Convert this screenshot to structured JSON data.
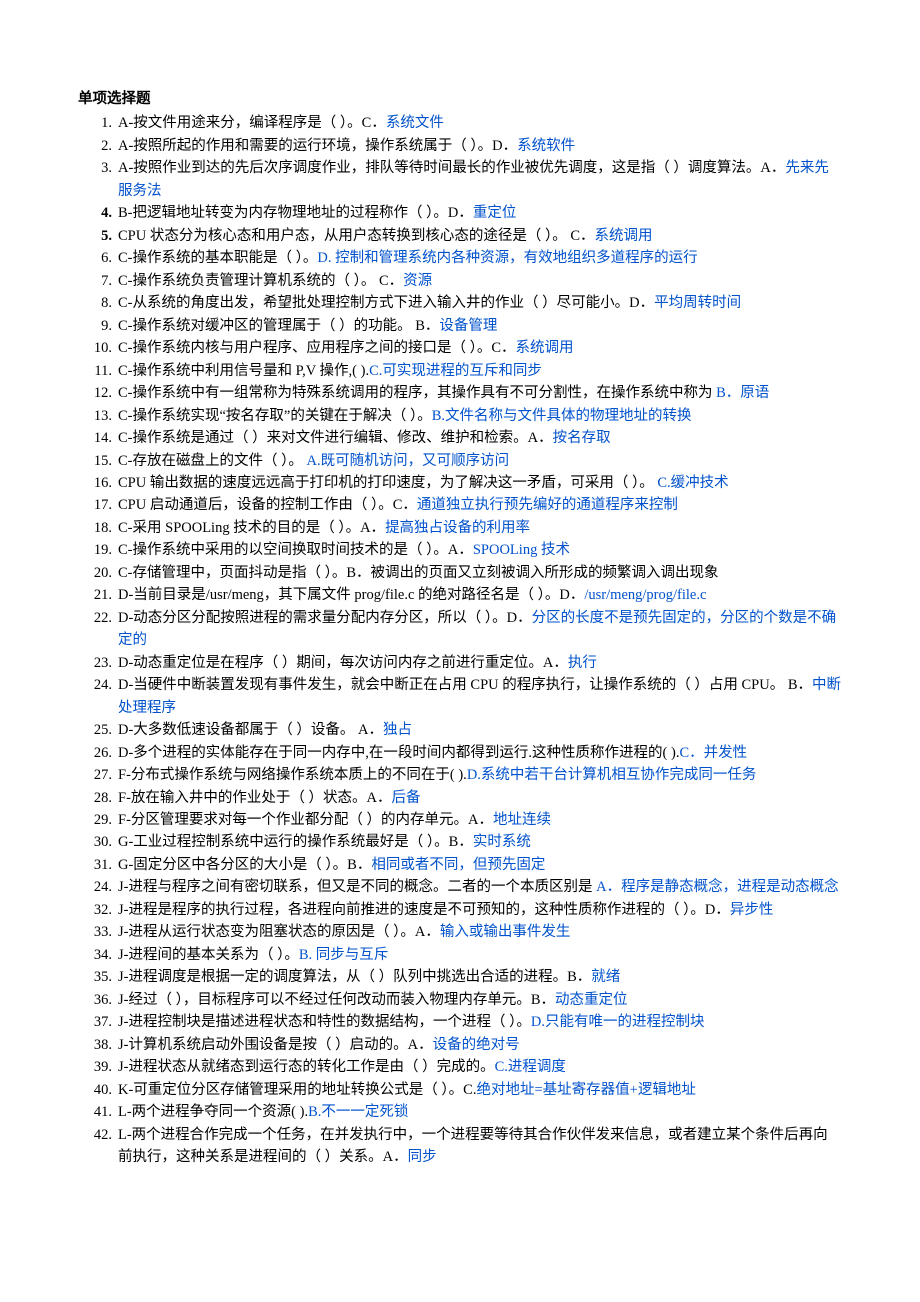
{
  "heading": "单项选择题",
  "items": [
    {
      "num": "1.",
      "bold": false,
      "parts": [
        {
          "t": "A-按文件用途来分，编译程序是（     ）。C．"
        },
        {
          "t": "系统文件",
          "ans": true
        }
      ]
    },
    {
      "num": "2.",
      "bold": false,
      "parts": [
        {
          "t": "A-按照所起的作用和需要的运行环境，操作系统属于（     ）。D．"
        },
        {
          "t": "系统软件",
          "ans": true
        }
      ]
    },
    {
      "num": "3.",
      "bold": false,
      "parts": [
        {
          "t": "A-按照作业到达的先后次序调度作业，排队等待时间最长的作业被优先调度，这是指（  ）调度算法。A．"
        },
        {
          "t": "先来先服务法",
          "ans": true
        }
      ]
    },
    {
      "num": "4.",
      "bold": true,
      "parts": [
        {
          "t": "B-把逻辑地址转变为内存物理地址的过程称作（    ）。D．"
        },
        {
          "t": "重定位",
          "ans": true
        }
      ]
    },
    {
      "num": "5.",
      "bold": true,
      "parts": [
        {
          "t": "CPU 状态分为核心态和用户态，从用户态转换到核心态的途径是（    ）。 C．"
        },
        {
          "t": "系统调用",
          "ans": true
        }
      ]
    },
    {
      "num": "6.",
      "bold": false,
      "parts": [
        {
          "t": "C-操作系统的基本职能是（    ）。"
        },
        {
          "t": "D. 控制和管理系统内各种资源，有效地组织多道程序的运行",
          "ans": true
        }
      ]
    },
    {
      "num": "7.",
      "bold": false,
      "parts": [
        {
          "t": "C-操作系统负责管理计算机系统的（     ）。  C．"
        },
        {
          "t": "资源",
          "ans": true
        }
      ]
    },
    {
      "num": "8.",
      "bold": false,
      "parts": [
        {
          "t": "C-从系统的角度出发，希望批处理控制方式下进入输入井的作业（     ）尽可能小。D．"
        },
        {
          "t": "平均周转时间",
          "ans": true
        }
      ]
    },
    {
      "num": "9.",
      "bold": false,
      "parts": [
        {
          "t": "C-操作系统对缓冲区的管理属于（     ）的功能。  B．"
        },
        {
          "t": "设备管理",
          "ans": true
        }
      ]
    },
    {
      "num": "10.",
      "bold": false,
      "parts": [
        {
          "t": "C-操作系统内核与用户程序、应用程序之间的接口是（     ）。C．"
        },
        {
          "t": "系统调用",
          "ans": true
        }
      ]
    },
    {
      "num": "11.",
      "bold": false,
      "parts": [
        {
          "t": "C-操作系统中利用信号量和 P,V 操作,( )."
        },
        {
          "t": "C.可实现进程的互斥和同步",
          "ans": true
        }
      ]
    },
    {
      "num": "12.",
      "bold": false,
      "parts": [
        {
          "t": "C-操作系统中有一组常称为特殊系统调用的程序，其操作具有不可分割性，在操作系统中称为 "
        },
        {
          "t": "B．原语",
          "ans": true
        }
      ]
    },
    {
      "num": "13.",
      "bold": false,
      "parts": [
        {
          "t": "C-操作系统实现“按名存取”的关键在于解决（    ）。"
        },
        {
          "t": "B.文件名称与文件具体的物理地址的转换",
          "ans": true
        }
      ]
    },
    {
      "num": "14.",
      "bold": false,
      "parts": [
        {
          "t": "C-操作系统是通过（     ）来对文件进行编辑、修改、维护和检索。A．"
        },
        {
          "t": "按名存取",
          "ans": true
        }
      ]
    },
    {
      "num": "15.",
      "bold": false,
      "parts": [
        {
          "t": "C-存放在磁盘上的文件（     ）。  "
        },
        {
          "t": "A.既可随机访问，又可顺序访问",
          "ans": true
        }
      ]
    },
    {
      "num": "16.",
      "bold": false,
      "parts": [
        {
          "t": "CPU 输出数据的速度远远高于打印机的打印速度，为了解决这一矛盾，可采用（    ）。   "
        },
        {
          "t": "C.缓冲技术",
          "ans": true
        }
      ]
    },
    {
      "num": "17.",
      "bold": false,
      "parts": [
        {
          "t": "CPU 启动通道后，设备的控制工作由（    ）。C．"
        },
        {
          "t": "通道独立执行预先编好的通道程序来控制",
          "ans": true
        }
      ]
    },
    {
      "num": "18.",
      "bold": false,
      "parts": [
        {
          "t": "C-采用 SPOOLing 技术的目的是（    ）。A．"
        },
        {
          "t": "提高独占设备的利用率",
          "ans": true
        }
      ]
    },
    {
      "num": "19.",
      "bold": false,
      "parts": [
        {
          "t": "C-操作系统中采用的以空间换取时间技术的是（    ）。A．"
        },
        {
          "t": "SPOOLing 技术",
          "ans": true
        }
      ]
    },
    {
      "num": "20.",
      "bold": false,
      "parts": [
        {
          "t": "C-存储管理中，页面抖动是指（    ）。B．被调出的页面又立刻被调入所形成的频繁调入调出现象"
        }
      ]
    },
    {
      "num": "21.",
      "bold": false,
      "parts": [
        {
          "t": "D-当前目录是/usr/meng，其下属文件 prog/file.c 的绝对路径名是（     ）。D．"
        },
        {
          "t": "/usr/meng/prog/file.c",
          "ans": true
        }
      ]
    },
    {
      "num": "22.",
      "bold": false,
      "parts": [
        {
          "t": "D-动态分区分配按照进程的需求量分配内存分区，所以（     ）。D．"
        },
        {
          "t": "分区的长度不是预先固定的，分区的个数是不确定的",
          "ans": true
        }
      ]
    },
    {
      "num": "23.",
      "bold": false,
      "parts": [
        {
          "t": "D-动态重定位是在程序（     ）期间，每次访问内存之前进行重定位。A．"
        },
        {
          "t": "执行",
          "ans": true
        }
      ]
    },
    {
      "num": "24.",
      "bold": false,
      "parts": [
        {
          "t": "D-当硬件中断装置发现有事件发生，就会中断正在占用 CPU 的程序执行，让操作系统的（     ）占用 CPU。  B．"
        },
        {
          "t": "中断处理程序",
          "ans": true
        }
      ]
    },
    {
      "num": "25.",
      "bold": false,
      "parts": [
        {
          "t": "D-大多数低速设备都属于（     ）设备。  A．"
        },
        {
          "t": "独占",
          "ans": true
        }
      ]
    },
    {
      "num": "26.",
      "bold": false,
      "parts": [
        {
          "t": "D-多个进程的实体能存在于同一内存中,在一段时间内都得到运行.这种性质称作进程的( )."
        },
        {
          "t": "C．并发性",
          "ans": true
        }
      ]
    },
    {
      "num": "27.",
      "bold": false,
      "parts": [
        {
          "t": "F-分布式操作系统与网络操作系统本质上的不同在于( )."
        },
        {
          "t": "D.系统中若干台计算机相互协作完成同一任务",
          "ans": true
        }
      ]
    },
    {
      "num": "28.",
      "bold": false,
      "parts": [
        {
          "t": "F-放在输入井中的作业处于（     ）状态。A．"
        },
        {
          "t": "后备",
          "ans": true
        }
      ]
    },
    {
      "num": "29.",
      "bold": false,
      "parts": [
        {
          "t": "F-分区管理要求对每一个作业都分配（     ）的内存单元。A．"
        },
        {
          "t": "地址连续",
          "ans": true
        }
      ]
    },
    {
      "num": "30.",
      "bold": false,
      "parts": [
        {
          "t": "G-工业过程控制系统中运行的操作系统最好是（    ）。B．"
        },
        {
          "t": "实时系统",
          "ans": true
        }
      ]
    },
    {
      "num": "31.",
      "bold": false,
      "parts": [
        {
          "t": "G-固定分区中各分区的大小是（    ）。B．"
        },
        {
          "t": "相同或者不同，但预先固定",
          "ans": true
        }
      ]
    },
    {
      "num": "24.",
      "bold": false,
      "parts": [
        {
          "t": "J-进程与程序之间有密切联系，但又是不同的概念。二者的一个本质区别是 "
        },
        {
          "t": "A．程序是静态概念，进程是动态概念",
          "ans": true
        }
      ]
    },
    {
      "num": "32.",
      "bold": false,
      "parts": [
        {
          "t": "J-进程是程序的执行过程，各进程向前推进的速度是不可预知的，这种性质称作进程的（     ）。D．"
        },
        {
          "t": "异步性",
          "ans": true
        }
      ]
    },
    {
      "num": "33.",
      "bold": false,
      "parts": [
        {
          "t": "J-进程从运行状态变为阻塞状态的原因是（     ）。A．"
        },
        {
          "t": "输入或输出事件发生",
          "ans": true
        }
      ]
    },
    {
      "num": "34.",
      "bold": false,
      "parts": [
        {
          "t": "J-进程间的基本关系为（     ）。"
        },
        {
          "t": "B. 同步与互斥",
          "ans": true
        }
      ]
    },
    {
      "num": "35.",
      "bold": false,
      "parts": [
        {
          "t": "J-进程调度是根据一定的调度算法，从（     ）队列中挑选出合适的进程。B．"
        },
        {
          "t": "就绪",
          "ans": true
        }
      ]
    },
    {
      "num": "36.",
      "bold": false,
      "parts": [
        {
          "t": "J-经过（    ），目标程序可以不经过任何改动而装入物理内存单元。B．"
        },
        {
          "t": "动态重定位",
          "ans": true
        }
      ]
    },
    {
      "num": "37.",
      "bold": false,
      "parts": [
        {
          "t": "J-进程控制块是描述进程状态和特性的数据结构，一个进程（     ）。"
        },
        {
          "t": "D.只能有唯一的进程控制块",
          "ans": true
        }
      ]
    },
    {
      "num": "38.",
      "bold": false,
      "parts": [
        {
          "t": "J-计算机系统启动外围设备是按（     ）启动的。A．"
        },
        {
          "t": "设备的绝对号",
          "ans": true
        }
      ]
    },
    {
      "num": "39.",
      "bold": false,
      "parts": [
        {
          "t": "J-进程状态从就绪态到运行态的转化工作是由（     ）完成的。"
        },
        {
          "t": "C.进程调度",
          "ans": true
        }
      ]
    },
    {
      "num": "40.",
      "bold": false,
      "parts": [
        {
          "t": "K-可重定位分区存储管理采用的地址转换公式是（     ）。C."
        },
        {
          "t": "绝对地址=基址寄存器值+逻辑地址",
          "ans": true
        }
      ]
    },
    {
      "num": "41.",
      "bold": false,
      "parts": [
        {
          "t": "L-两个进程争夺同一个资源( )."
        },
        {
          "t": "B.不一一定死锁",
          "ans": true
        }
      ]
    },
    {
      "num": "42.",
      "bold": false,
      "parts": [
        {
          "t": "L-两个进程合作完成一个任务，在并发执行中，一个进程要等待其合作伙伴发来信息，或者建立某个条件后再向前执行，这种关系是进程间的（     ）关系。A．"
        },
        {
          "t": "同步",
          "ans": true
        }
      ]
    }
  ]
}
